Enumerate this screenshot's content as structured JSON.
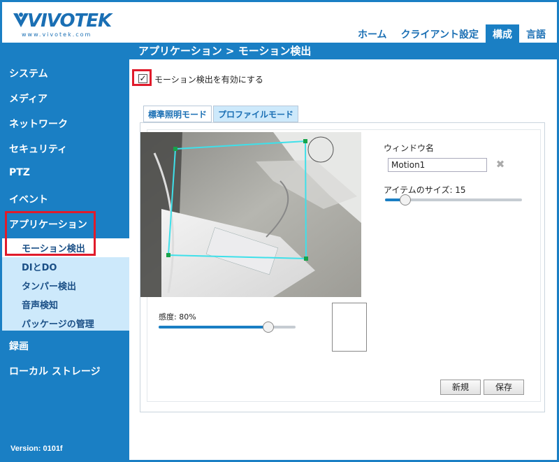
{
  "brand": {
    "name": "VIVOTEK",
    "url": "www.vivotek.com"
  },
  "topnav": [
    {
      "label": "ホーム",
      "active": false
    },
    {
      "label": "クライアント設定",
      "active": false
    },
    {
      "label": "構成",
      "active": true
    },
    {
      "label": "言語",
      "active": false
    }
  ],
  "page_title": "アプリケーション > モーション検出",
  "sidebar": {
    "items": [
      {
        "label": "システム"
      },
      {
        "label": "メディア"
      },
      {
        "label": "ネットワーク"
      },
      {
        "label": "セキュリティ"
      },
      {
        "label": "PTZ"
      },
      {
        "label": "イベント"
      },
      {
        "label": "アプリケーション"
      },
      {
        "label": "録画"
      },
      {
        "label": "ローカル ストレージ"
      }
    ],
    "subitems": [
      {
        "label": "モーション検出",
        "active": true
      },
      {
        "label": "DIとDO",
        "active": false
      },
      {
        "label": "タンパー検出",
        "active": false
      },
      {
        "label": "音声検知",
        "active": false
      },
      {
        "label": "パッケージの管理",
        "active": false
      }
    ],
    "version": "Version: 0101f"
  },
  "enable": {
    "label": "モーション検出を有効にする",
    "checked": true,
    "checkmark": "✓"
  },
  "tabs": [
    {
      "label": "標準照明モード",
      "active": false
    },
    {
      "label": "プロファイルモード",
      "active": true
    }
  ],
  "sensitivity": {
    "label": "感度: 80%",
    "value_percent": 80
  },
  "window": {
    "name_label": "ウィンドウ名",
    "name_value": "Motion1",
    "delete_icon": "✖",
    "size_label": "アイテムのサイズ: 15",
    "size_fraction": 0.15
  },
  "buttons": {
    "new": "新規",
    "save": "保存"
  },
  "colors": {
    "accent": "#1a7fc4",
    "highlight": "#e01b2b",
    "motion_window": "#3ee0ea",
    "submenu_bg": "#cde9fb"
  }
}
